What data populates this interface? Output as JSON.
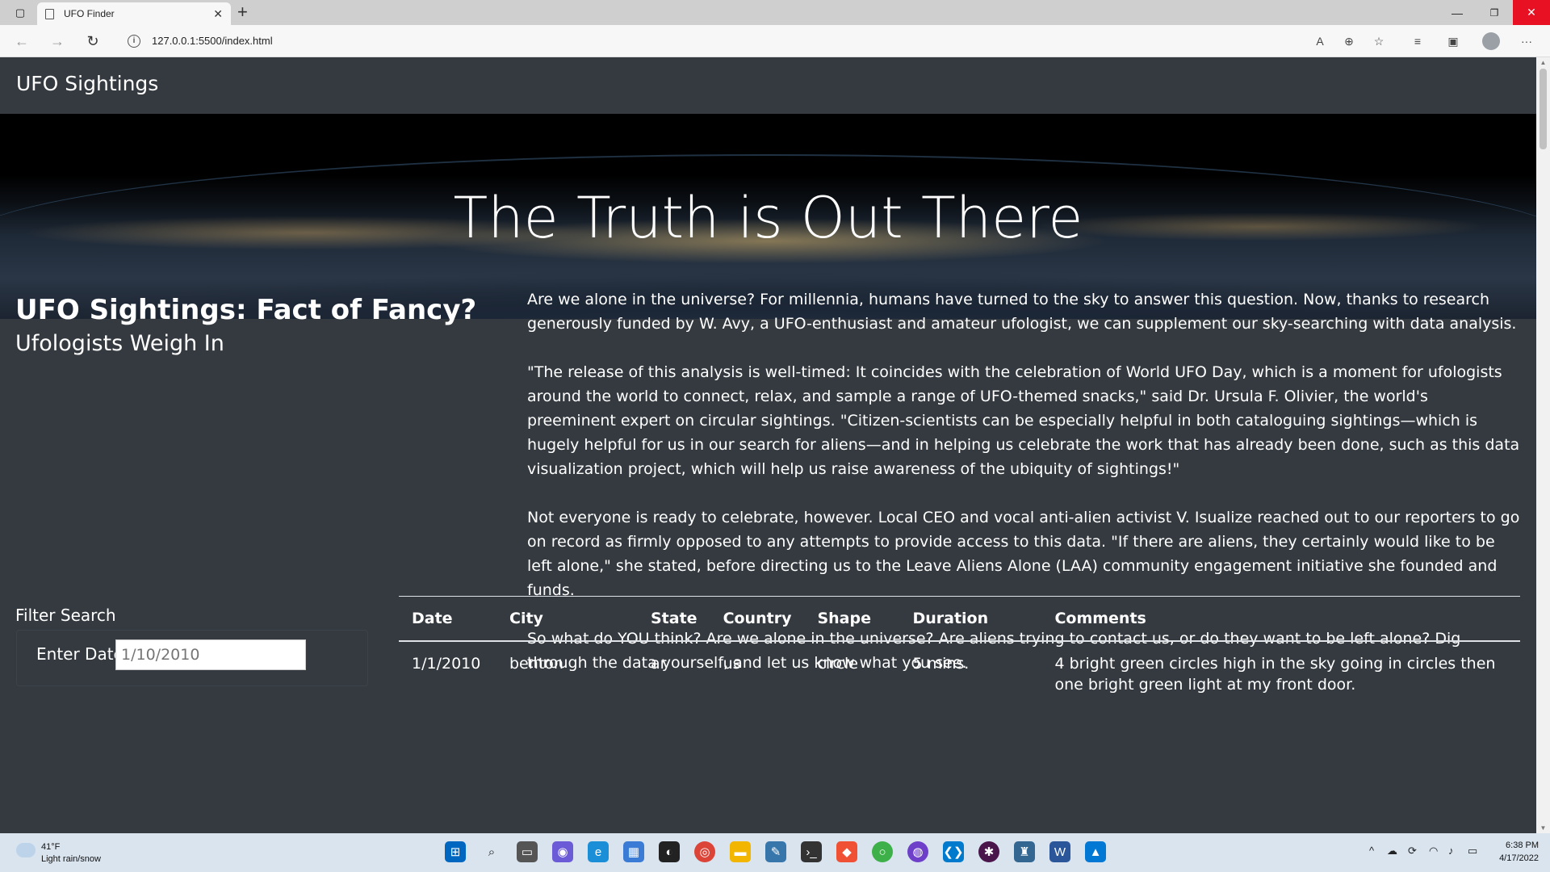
{
  "browser": {
    "tab_title": "UFO Finder",
    "tab_close": "✕",
    "new_tab": "+",
    "url": "127.0.0.1:5500/index.html",
    "window_controls": {
      "minimize": "—",
      "restore": "❐",
      "close": "✕"
    },
    "nav": {
      "back": "←",
      "forward": "→",
      "reload": "↻"
    },
    "toolbar_icons": [
      "read-aloud-icon",
      "zoom-icon",
      "favorite-add-icon",
      "favorites-icon",
      "collections-icon",
      "profile-icon",
      "more-icon"
    ]
  },
  "page": {
    "brand": "UFO Sightings",
    "hero_title": "The Truth is Out There",
    "lead_title": "UFO Sightings: Fact of Fancy?",
    "lead_subtitle": "Ufologists Weigh In",
    "article": [
      "Are we alone in the universe? For millennia, humans have turned to the sky to answer this question. Now, thanks to research generously funded by W. Avy, a UFO-enthusiast and amateur ufologist, we can supplement our sky-searching with data analysis.",
      "\"The release of this analysis is well-timed: It coincides with the celebration of World UFO Day, which is a moment for ufologists around the world to connect, relax, and sample a range of UFO-themed snacks,\" said Dr. Ursula F. Olivier, the world's preeminent expert on circular sightings. \"Citizen-scientists can be especially helpful in both cataloguing sightings—which is hugely helpful for us in our search for aliens—and in helping us celebrate the work that has already been done, such as this data visualization project, which will help us raise awareness of the ubiquity of sightings!\"",
      "Not everyone is ready to celebrate, however. Local CEO and vocal anti-alien activist V. Isualize reached out to our reporters to go on record as firmly opposed to any attempts to provide access to this data. \"If there are aliens, they certainly would like to be left alone,\" she stated, before directing us to the Leave Aliens Alone (LAA) community engagement initiative she founded and funds.",
      "So what do YOU think? Are we alone in the universe? Are aliens trying to contact us, or do they want to be left alone? Dig through the data yourself, and let us know what you see."
    ],
    "filter": {
      "heading": "Filter Search",
      "date_label": "Enter Date",
      "date_placeholder": "1/10/2010"
    },
    "table": {
      "columns": [
        "Date",
        "City",
        "State",
        "Country",
        "Shape",
        "Duration",
        "Comments"
      ],
      "rows": [
        [
          "1/1/2010",
          "benton",
          "ar",
          "us",
          "circle",
          "5 mins.",
          "4 bright green circles high in the sky going in circles then one bright green light at my front door."
        ]
      ]
    }
  },
  "taskbar": {
    "weather_temp": "41°F",
    "weather_desc": "Light rain/snow",
    "time": "6:38 PM",
    "date": "4/17/2022",
    "apps": [
      "start-icon",
      "search-icon",
      "task-view-icon",
      "chat-icon",
      "edge-icon",
      "store-icon",
      "github-icon",
      "chrome-icon",
      "file-explorer-icon",
      "python-icon",
      "terminal-icon",
      "git-icon",
      "anaconda-icon",
      "github-desktop-icon",
      "vscode-icon",
      "slack-icon",
      "postgres-icon",
      "word-icon",
      "photos-icon"
    ],
    "accent": "#0067c0"
  }
}
